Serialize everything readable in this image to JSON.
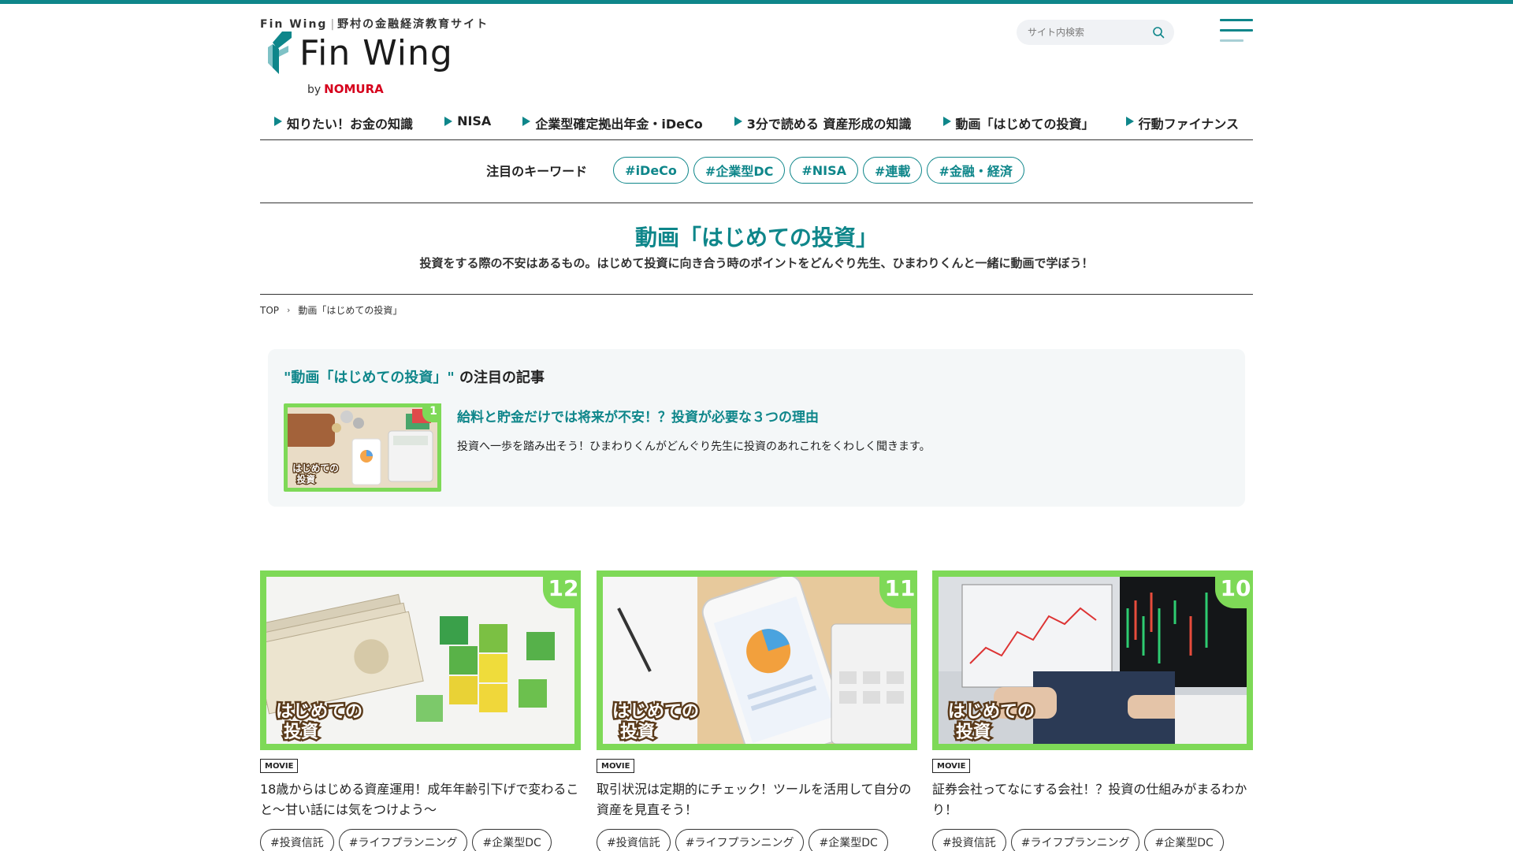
{
  "header": {
    "tagline_brand": "Fin Wing",
    "tagline_sep": "|",
    "tagline_text": "野村の金融経済教育サイト",
    "logo_text": "Fin Wing",
    "logo_by": "by",
    "logo_company": "NOMURA",
    "search_placeholder": "サイト内検索"
  },
  "nav": {
    "items": [
      {
        "label": "知りたい！お金の知識"
      },
      {
        "label": "NISA"
      },
      {
        "label": "企業型確定拠出年金・iDeCo"
      },
      {
        "label": "3分で読める 資産形成の知識"
      },
      {
        "label": "動画「はじめての投資」"
      },
      {
        "label": "行動ファイナンス"
      }
    ]
  },
  "keywords": {
    "label": "注目のキーワード",
    "tags": [
      "#iDeCo",
      "#企業型DC",
      "#NISA",
      "#連載",
      "#金融・経済"
    ]
  },
  "page": {
    "title": "動画「はじめての投資」",
    "description": "投資をする際の不安はあるもの。はじめて投資に向き合う時のポイントをどんぐり先生、ひまわりくんと一緒に動画で学ぼう！"
  },
  "breadcrumb": {
    "home": "TOP",
    "current": "動画「はじめての投資」"
  },
  "featured": {
    "heading_accent": "\"動画「はじめての投資」\"",
    "heading_rest": " の注目の記事",
    "badge": "1",
    "title": "給料と貯金だけでは将来が不安！？投資が必要な３つの理由",
    "description": "投資へ一歩を踏み出そう！ひまわりくんがどんぐり先生に投資のあれこれをくわしく聞きます。"
  },
  "cards": [
    {
      "number": "12",
      "category": "MOVIE",
      "title": "18歳からはじめる資産運用！成年年齢引下げで変わること〜甘い話には気をつけよう〜",
      "tags": [
        "#投資信託",
        "#ライフプランニング",
        "#企業型DC"
      ]
    },
    {
      "number": "11",
      "category": "MOVIE",
      "title": "取引状況は定期的にチェック！ツールを活用して自分の資産を見直そう！",
      "tags": [
        "#投資信託",
        "#ライフプランニング",
        "#企業型DC"
      ]
    },
    {
      "number": "10",
      "category": "MOVIE",
      "title": "証券会社ってなにする会社！？投資の仕組みがまるわかり！",
      "tags": [
        "#投資信託",
        "#ライフプランニング",
        "#企業型DC"
      ]
    }
  ],
  "stamp_text": {
    "line1": "はじめての",
    "line2": "投資"
  },
  "colors": {
    "accent": "#0e868a",
    "thumb_frame": "#7ed957",
    "brand_red": "#d6001c"
  },
  "icons": {
    "search": "search-icon",
    "menu": "hamburger-menu-icon",
    "nav_bullet": "triangle-right-icon",
    "breadcrumb_sep": "chevron-right-icon"
  }
}
